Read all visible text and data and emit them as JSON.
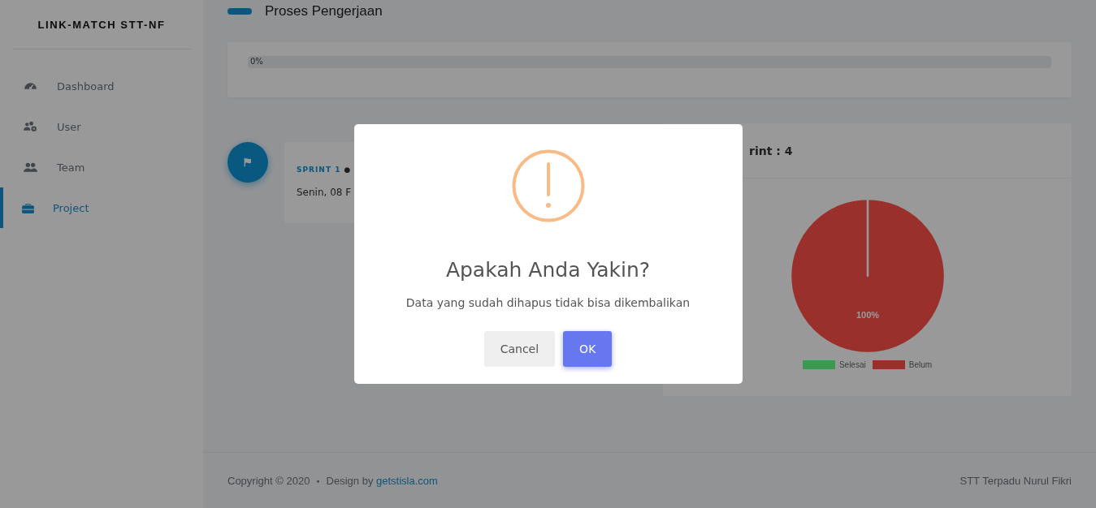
{
  "sidebar": {
    "brand": "LINK-MATCH STT-NF",
    "items": [
      {
        "label": "Dashboard",
        "selected": false
      },
      {
        "label": "User",
        "selected": false
      },
      {
        "label": "Team",
        "selected": false
      },
      {
        "label": "Project",
        "selected": true
      }
    ]
  },
  "section_title": "Proses Pengerjaan",
  "progress": {
    "level": 0,
    "label": "0%"
  },
  "sprint": {
    "title": "SPRINT 1",
    "separator": "●",
    "date": "Senin, 08 F"
  },
  "chart_card": {
    "title": "rint : 4",
    "chart_data": {
      "type": "pie",
      "categories": [
        "Selesai",
        "Belum"
      ],
      "values": [
        0,
        100
      ],
      "colors": [
        "#66ff85",
        "#ff5048"
      ],
      "value_labels": [
        null,
        "100%"
      ]
    }
  },
  "footer": {
    "copyright": "Copyright © 2020",
    "separator": "●",
    "design_by": "Design by",
    "link": "getstisla.com",
    "right": "STT Terpadu Nurul Fikri"
  },
  "dialog": {
    "title": "Apakah Anda Yakin?",
    "text": "Data yang sudah dihapus tidak bisa dikembalikan",
    "buttons": [
      {
        "label": "Cancel",
        "kind": "cancel"
      },
      {
        "label": "OK",
        "kind": "confirm"
      }
    ]
  }
}
